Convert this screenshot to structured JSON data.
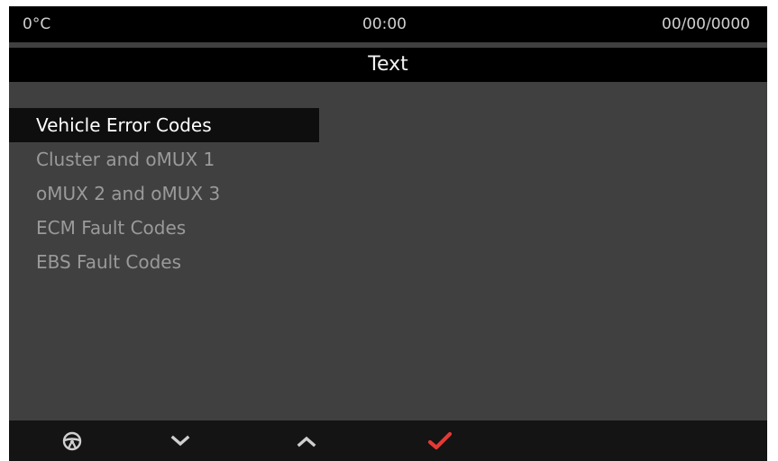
{
  "status": {
    "temperature": "0°C",
    "time": "00:00",
    "date": "00/00/0000"
  },
  "title": "Text",
  "menu": {
    "items": [
      {
        "label": "Vehicle Error Codes",
        "selected": true
      },
      {
        "label": "Cluster and oMUX 1",
        "selected": false
      },
      {
        "label": "oMUX 2 and oMUX 3",
        "selected": false
      },
      {
        "label": "ECM Fault Codes",
        "selected": false
      },
      {
        "label": "EBS Fault Codes",
        "selected": false
      }
    ]
  },
  "softkeys": [
    {
      "icon": "steering-wheel-icon"
    },
    {
      "icon": "chevron-down-icon"
    },
    {
      "icon": "chevron-up-icon"
    },
    {
      "icon": "checkmark-icon",
      "color": "#e53935"
    }
  ],
  "colors": {
    "background": "#404040",
    "bar": "#000000",
    "selected_row": "#0e0e0e",
    "item_text": "#9a9a9a",
    "selected_text": "#ffffff",
    "accept": "#e53935"
  }
}
